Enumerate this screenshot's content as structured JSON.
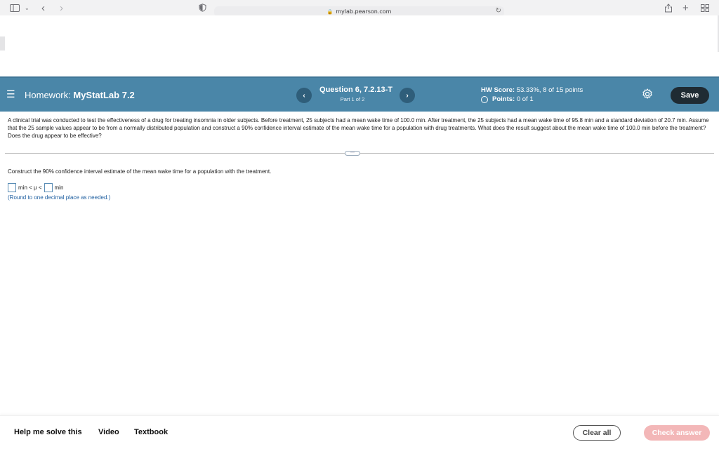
{
  "browser": {
    "url": "mylab.pearson.com",
    "lock_glyph": "🔒",
    "back_glyph": "‹",
    "forward_glyph": "›",
    "reload_glyph": "↻"
  },
  "header": {
    "hw_prefix": "Homework:",
    "hw_name": "MyStatLab 7.2",
    "question_title": "Question 6, 7.2.13-T",
    "question_part": "Part 1 of 2",
    "score_label": "HW Score:",
    "score_value": "53.33%, 8 of 15 points",
    "points_label": "Points:",
    "points_value": "0 of 1",
    "prev_glyph": "‹",
    "next_glyph": "›",
    "save_label": "Save",
    "bar_color": "#4a86a8"
  },
  "question": {
    "problem_text": "A clinical trial was conducted to test the effectiveness of a drug for treating insomnia in older subjects. Before treatment, 25 subjects had a mean wake time of 100.0 min. After treatment, the 25 subjects had a mean wake time of 95.8 min and a standard deviation of 20.7 min. Assume that the 25 sample values appear to be from a normally distributed population and construct a 90% confidence interval estimate of the mean wake time for a population with drug treatments. What does the result suggest about the mean wake time of 100.0 min before the treatment? Does the drug appear to be effective?",
    "expander_glyph": "⋯",
    "instruction": "Construct the 90% confidence interval estimate of the mean wake time for a population with the treatment.",
    "lower_value": "",
    "middle_text": "min < μ <",
    "upper_value": "",
    "unit": "min",
    "round_note": "(Round to one decimal place as needed.)"
  },
  "footer": {
    "help_label": "Help me solve this",
    "video_label": "Video",
    "textbook_label": "Textbook",
    "clear_label": "Clear all",
    "check_label": "Check answer"
  }
}
